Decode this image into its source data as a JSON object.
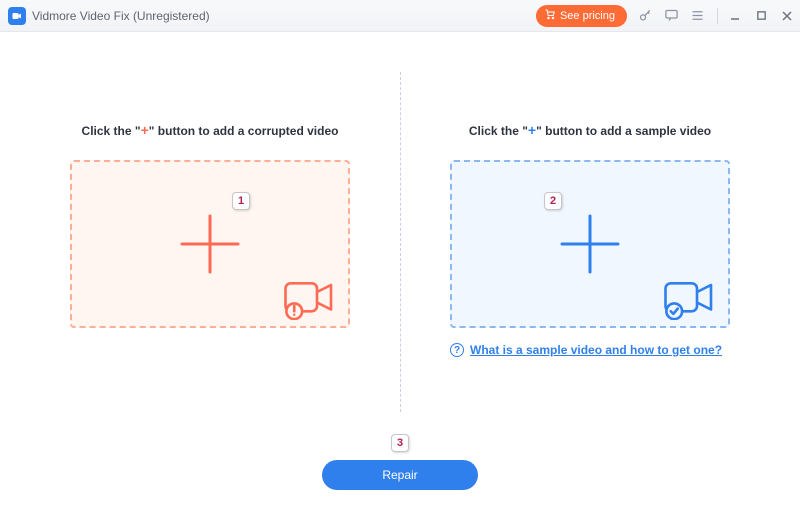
{
  "titlebar": {
    "app_title": "Vidmore Video Fix (Unregistered)",
    "pricing_label": "See pricing"
  },
  "panes": {
    "corrupt": {
      "heading_pre": "Click the \"",
      "heading_plus": "+",
      "heading_post": "\" button to add a corrupted video"
    },
    "sample": {
      "heading_pre": "Click the \"",
      "heading_plus": "+",
      "heading_post": "\" button to add a sample video",
      "help_text": "What is a sample video and how to get one?"
    }
  },
  "footer": {
    "repair_label": "Repair"
  },
  "callouts": {
    "one": "1",
    "two": "2",
    "three": "3"
  },
  "colors": {
    "accent_blue": "#2f80ed",
    "accent_orange": "#ff6b35",
    "plus_red": "#ff6b52"
  }
}
